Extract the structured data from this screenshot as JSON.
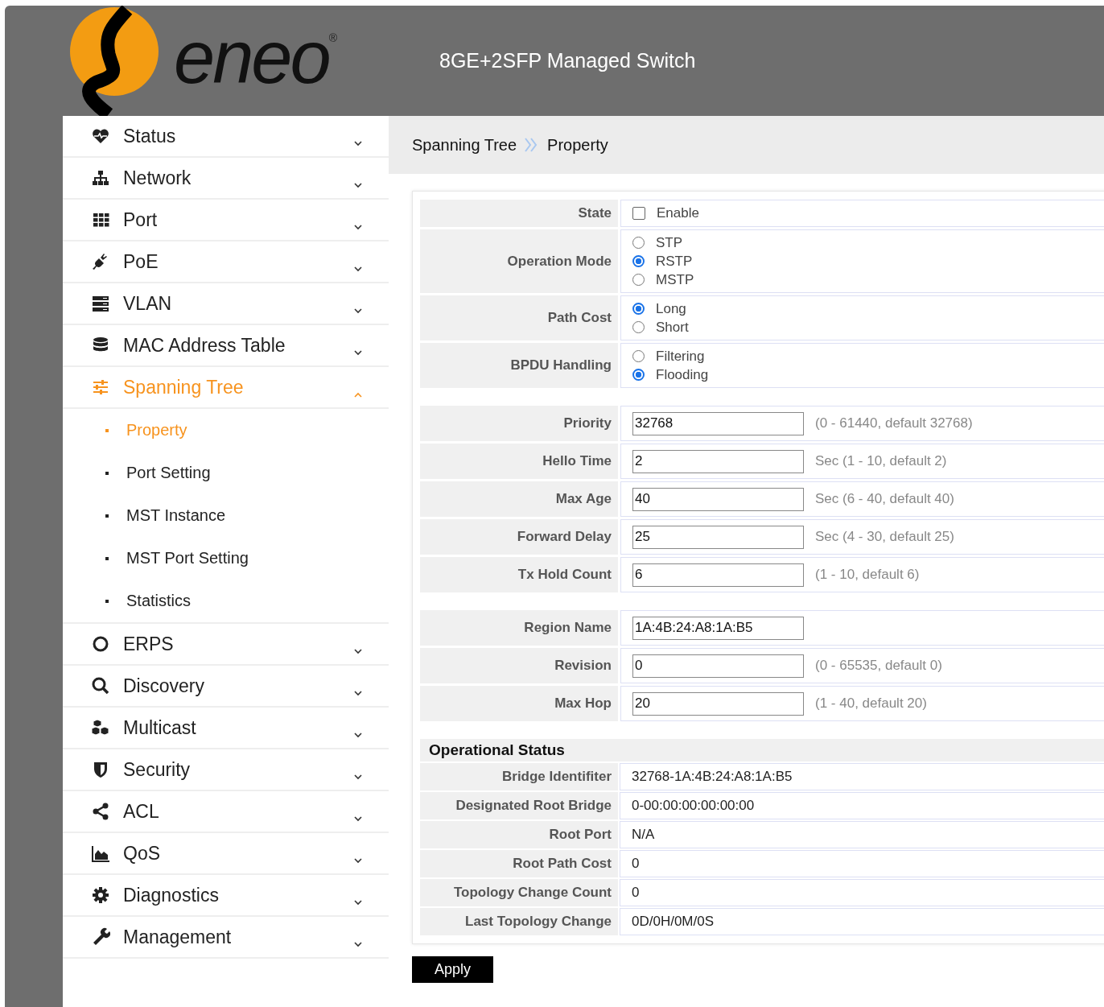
{
  "header": {
    "logo": "eneo",
    "logo_mark": "®",
    "title": "8GE+2SFP Managed Switch"
  },
  "sidebar": {
    "items": [
      {
        "label": "Status",
        "expanded": false,
        "selected": false
      },
      {
        "label": "Network",
        "expanded": false,
        "selected": false
      },
      {
        "label": "Port",
        "expanded": false,
        "selected": false
      },
      {
        "label": "PoE",
        "expanded": false,
        "selected": false
      },
      {
        "label": "VLAN",
        "expanded": false,
        "selected": false
      },
      {
        "label": "MAC Address Table",
        "expanded": false,
        "selected": false
      },
      {
        "label": "Spanning Tree",
        "expanded": true,
        "selected": true,
        "children": [
          {
            "label": "Property",
            "selected": true
          },
          {
            "label": "Port Setting",
            "selected": false
          },
          {
            "label": "MST Instance",
            "selected": false
          },
          {
            "label": "MST Port Setting",
            "selected": false
          },
          {
            "label": "Statistics",
            "selected": false
          }
        ]
      },
      {
        "label": "ERPS",
        "expanded": false,
        "selected": false
      },
      {
        "label": "Discovery",
        "expanded": false,
        "selected": false
      },
      {
        "label": "Multicast",
        "expanded": false,
        "selected": false
      },
      {
        "label": "Security",
        "expanded": false,
        "selected": false
      },
      {
        "label": "ACL",
        "expanded": false,
        "selected": false
      },
      {
        "label": "QoS",
        "expanded": false,
        "selected": false
      },
      {
        "label": "Diagnostics",
        "expanded": false,
        "selected": false
      },
      {
        "label": "Management",
        "expanded": false,
        "selected": false
      }
    ]
  },
  "breadcrumb": [
    "Spanning Tree",
    "Property"
  ],
  "settings": [
    [
      {
        "kind": "checkbox",
        "label": "State",
        "options": [
          {
            "label": "Enable",
            "checked": false
          }
        ]
      },
      {
        "kind": "radio",
        "label": "Operation Mode",
        "options": [
          {
            "label": "STP",
            "selected": false
          },
          {
            "label": "RSTP",
            "selected": true
          },
          {
            "label": "MSTP",
            "selected": false
          }
        ]
      },
      {
        "kind": "radio",
        "label": "Path Cost",
        "options": [
          {
            "label": "Long",
            "selected": true
          },
          {
            "label": "Short",
            "selected": false
          }
        ]
      },
      {
        "kind": "radio",
        "label": "BPDU Handling",
        "options": [
          {
            "label": "Filtering",
            "selected": false
          },
          {
            "label": "Flooding",
            "selected": true
          }
        ]
      }
    ],
    [
      {
        "kind": "input",
        "label": "Priority",
        "value": "32768",
        "hint": "(0 - 61440, default 32768)"
      },
      {
        "kind": "input",
        "label": "Hello Time",
        "value": "2",
        "hint": "Sec (1 - 10, default 2)"
      },
      {
        "kind": "input",
        "label": "Max Age",
        "value": "40",
        "hint": "Sec (6 - 40, default 40)"
      },
      {
        "kind": "input",
        "label": "Forward Delay",
        "value": "25",
        "hint": "Sec (4 - 30, default 25)"
      },
      {
        "kind": "input",
        "label": "Tx Hold Count",
        "value": "6",
        "hint": "(1 - 10, default 6)"
      }
    ],
    [
      {
        "kind": "input",
        "label": "Region Name",
        "value": "1A:4B:24:A8:1A:B5"
      },
      {
        "kind": "input",
        "label": "Revision",
        "value": "0",
        "hint": "(0 - 65535, default 0)"
      },
      {
        "kind": "input",
        "label": "Max Hop",
        "value": "20",
        "hint": "(1 - 40, default 20)"
      }
    ]
  ],
  "operational_status": {
    "title": "Operational Status",
    "rows": [
      {
        "label": "Bridge Identifiter",
        "value": "32768-1A:4B:24:A8:1A:B5"
      },
      {
        "label": "Designated Root Bridge",
        "value": "0-00:00:00:00:00:00"
      },
      {
        "label": "Root Port",
        "value": "N/A"
      },
      {
        "label": "Root Path Cost",
        "value": "0"
      },
      {
        "label": "Topology Change Count",
        "value": "0"
      },
      {
        "label": "Last Topology Change",
        "value": "0D/0H/0M/0S"
      }
    ]
  },
  "buttons": [
    "Apply"
  ]
}
